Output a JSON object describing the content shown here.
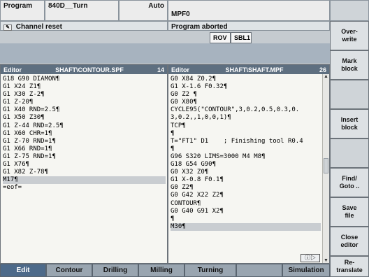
{
  "header": {
    "program_label": "Program",
    "machine": "840D__Turn",
    "mode": "Auto",
    "program_name": "MPF0",
    "channel_status": "Channel reset",
    "program_status": "Program aborted",
    "tag_rov": "ROV",
    "tag_sbl": "SBL1"
  },
  "editor_left": {
    "title": "Editor",
    "path": "SHAFT\\CONTOUR.SPF",
    "lines_count": "14",
    "lines": [
      "G18 G90 DIAMON¶",
      "G1 X24 Z1¶",
      "G1 X30 Z-2¶",
      "G1 Z-20¶",
      "G1 X40 RND=2.5¶",
      "G1 X50 Z30¶",
      "G1 Z-44 RND=2.5¶",
      "G1 X60 CHR=1¶",
      "G1 Z-70 RND=1¶",
      "G1 X66 RND=1¶",
      "G1 Z-75 RND=1¶",
      "G1 X76¶",
      "G1 X82 Z-78¶",
      "M17¶",
      "=eof="
    ]
  },
  "editor_right": {
    "title": "Editor",
    "path": "SHAFT\\SHAFT.MPF",
    "lines_count": "26",
    "lines": [
      "G0 X84 Z0.2¶",
      "G1 X-1.6 F0.32¶",
      "G0 Z2 ¶",
      "G0 X80¶",
      "CYCLE95(\"CONTOUR\",3,0.2,0.5,0.3,0.",
      "3,0.2,,1,0,0,1)¶",
      "TCP¶",
      "¶",
      "T=\"FT1\" D1    ; Finishing tool R0.4",
      "¶",
      "G96 S320 LIMS=3000 M4 M8¶",
      "G18 G54 G90¶",
      "G0 X32 Z0¶",
      "G1 X-0.8 F0.1¶",
      "G0 Z2¶",
      "G0 G42 X22 Z2¶",
      "CONTOUR¶",
      "G0 G40 G91 X2¶",
      "¶",
      "M30¶"
    ]
  },
  "softkeys_right": [
    "Over-\nwrite",
    "Mark\nblock",
    "",
    "Insert\nblock",
    "",
    "Find/\nGoto ..",
    "Save\nfile",
    "Close\neditor",
    "Re-\ntranslate"
  ],
  "softkeys_bottom": [
    "Edit",
    "Contour",
    "Drilling",
    "Milling",
    "Turning",
    "",
    "Simulation"
  ],
  "icons": {
    "nav": "ⓘ▷"
  }
}
